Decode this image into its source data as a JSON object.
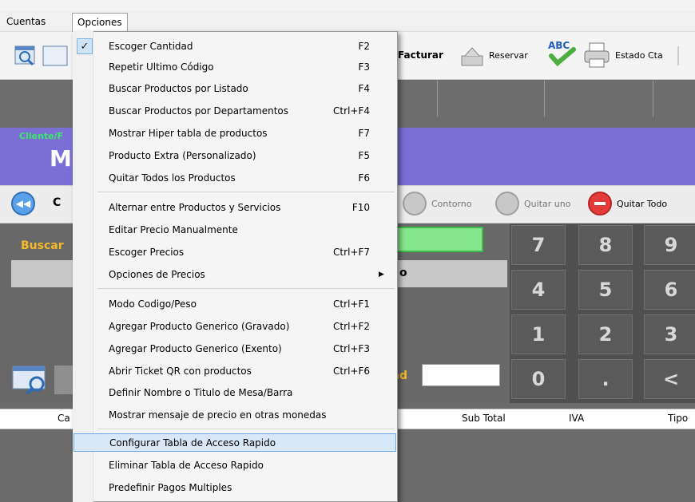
{
  "menubar": {
    "items": [
      "Cuentas",
      "Opciones"
    ]
  },
  "toolbar": {
    "facturar": "Facturar",
    "reservar": "Reservar",
    "abc_icon_text": "ABC",
    "estado_cta": "Estado Cta"
  },
  "banner": {
    "label_small": "Cliente/F",
    "label_big": "M"
  },
  "actionbar": {
    "left_letter": "C",
    "contorno": "Contorno",
    "quitar_uno": "Quitar uno",
    "quitar_todo": "Quitar Todo"
  },
  "main": {
    "buscar_label": "Buscar",
    "field_text": "o",
    "cantidad_suffix": "nd"
  },
  "keypad": {
    "keys": [
      "7",
      "8",
      "9",
      "4",
      "5",
      "6",
      "1",
      "2",
      "3",
      "0",
      ".",
      "<"
    ]
  },
  "table": {
    "headers": [
      "Ca",
      "Sub Total",
      "IVA",
      "Tipo"
    ]
  },
  "dropdown": {
    "items": [
      {
        "label": "Escoger Cantidad",
        "shortcut": "F2",
        "checked": true
      },
      {
        "label": "Repetir Ultimo Código",
        "shortcut": "F3"
      },
      {
        "label": "Buscar Productos por Listado",
        "shortcut": "F4"
      },
      {
        "label": "Buscar Productos por Departamentos",
        "shortcut": "Ctrl+F4"
      },
      {
        "label": "Mostrar Hiper tabla de productos",
        "shortcut": "F7"
      },
      {
        "label": "Producto Extra (Personalizado)",
        "shortcut": "F5"
      },
      {
        "label": "Quitar Todos los Productos",
        "shortcut": "F6"
      },
      {
        "label": "Alternar entre  Productos y Servicios",
        "shortcut": "F10"
      },
      {
        "label": "Editar Precio Manualmente",
        "shortcut": ""
      },
      {
        "label": "Escoger Precios",
        "shortcut": "Ctrl+F7"
      },
      {
        "label": "Opciones de Precios",
        "shortcut": "",
        "submenu": true
      },
      {
        "label": "Modo Codigo/Peso",
        "shortcut": "Ctrl+F1"
      },
      {
        "label": "Agregar Producto Generico (Gravado)",
        "shortcut": "Ctrl+F2"
      },
      {
        "label": "Agregar Producto Generico (Exento)",
        "shortcut": "Ctrl+F3"
      },
      {
        "label": "Abrir Ticket QR con productos",
        "shortcut": "Ctrl+F6"
      },
      {
        "label": "Definir Nombre o Titulo de Mesa/Barra",
        "shortcut": ""
      },
      {
        "label": "Mostrar mensaje de precio en otras monedas",
        "shortcut": ""
      },
      {
        "label": "Configurar Tabla de Acceso Rapido",
        "shortcut": "",
        "selected": true
      },
      {
        "label": "Eliminar Tabla de Acceso Rapido",
        "shortcut": ""
      },
      {
        "label": "Predefinir Pagos Multiples",
        "shortcut": ""
      }
    ]
  },
  "colors": {
    "banner": "#7b6fd6",
    "buscar_text": "#f5b928",
    "green_field": "#86e68d",
    "selection": "#d9e8f8"
  }
}
